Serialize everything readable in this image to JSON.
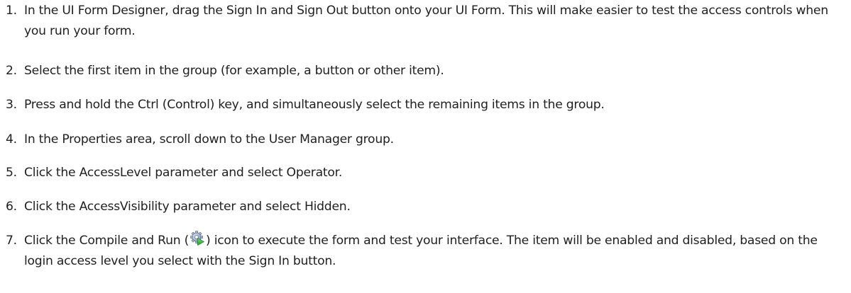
{
  "steps": [
    {
      "number": "1.",
      "text": "In the UI Form Designer, drag the Sign In and Sign Out button onto your UI Form. This will make easier to test the access controls when you run your form."
    },
    {
      "number": "2.",
      "text": "Select the first item in the group (for example, a button or other item)."
    },
    {
      "number": "3.",
      "text": "Press and hold the Ctrl (Control) key, and simultaneously select the remaining items in the group."
    },
    {
      "number": "4.",
      "text": "In the Properties area, scroll down to the User Manager group."
    },
    {
      "number": "5.",
      "text": "Click the AccessLevel parameter and select Operator."
    },
    {
      "number": "6.",
      "text": "Click the AccessVisibility parameter and select Hidden."
    },
    {
      "number": "7.",
      "text_before_icon": "Click the Compile and Run (",
      "icon": "compile-and-run-icon",
      "text_after_icon": ") icon to execute the form and test your interface. The item will be enabled and disabled, based on the login access level you select with the Sign In button."
    }
  ]
}
